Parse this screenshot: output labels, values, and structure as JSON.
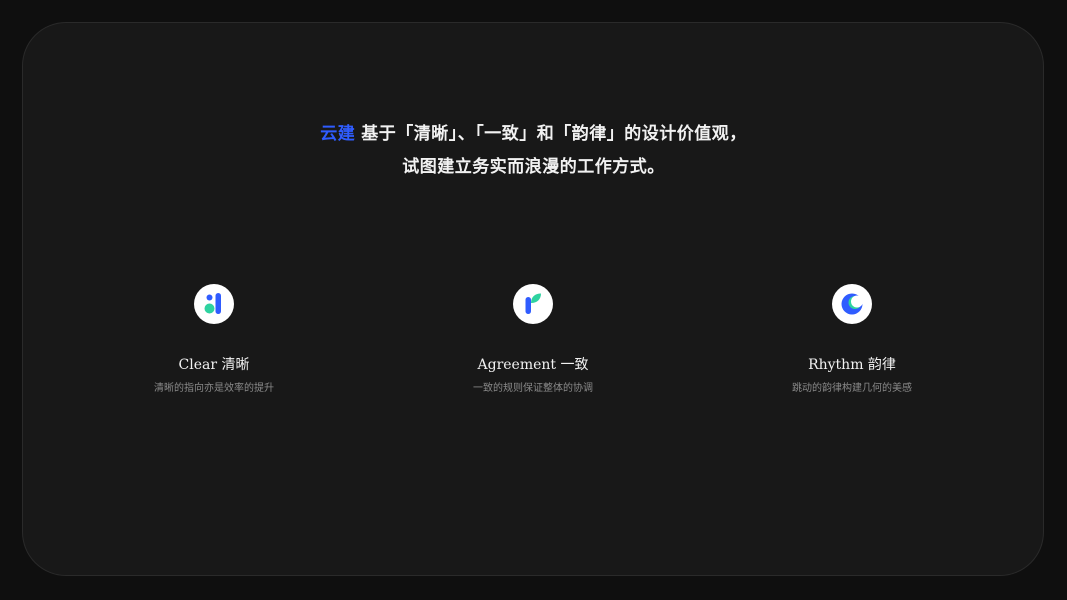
{
  "headline": {
    "brand": "云建",
    "line1_rest": "基于「清晰」、「一致」和「韵律」的设计价值观，",
    "line2": "试图建立务实而浪漫的工作方式。"
  },
  "features": [
    {
      "icon": "clarity-logo-icon",
      "title": "Clear 清晰",
      "desc": "清晰的指向亦是效率的提升"
    },
    {
      "icon": "sprout-logo-icon",
      "title": "Agreement 一致",
      "desc": "一致的规则保证整体的协调"
    },
    {
      "icon": "crescent-logo-icon",
      "title": "Rhythm 韵律",
      "desc": "跳动的韵律构建几何的美感"
    }
  ],
  "colors": {
    "brand_blue": "#2f5cff",
    "accent_green": "#2ed3a0",
    "background": "#0f0f0f",
    "card": "#181818"
  }
}
